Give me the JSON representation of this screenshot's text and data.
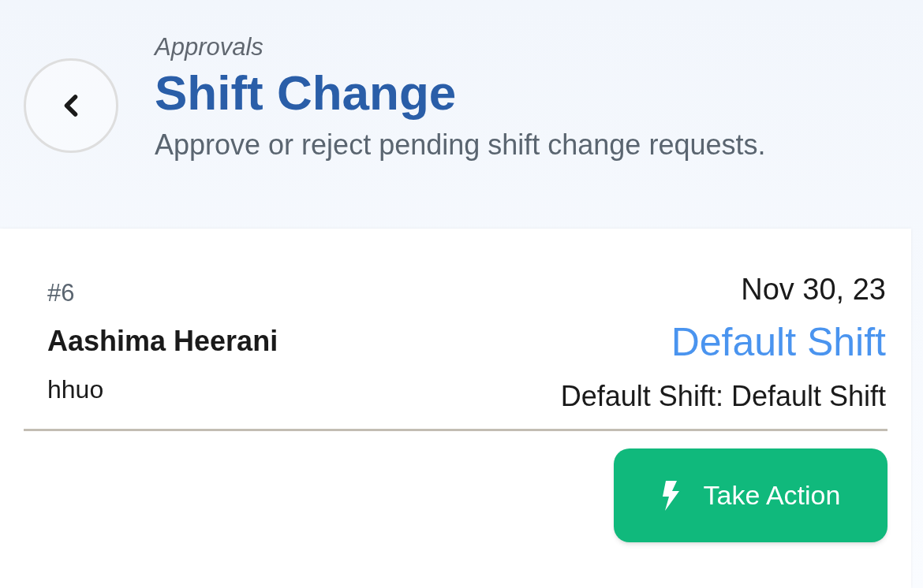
{
  "header": {
    "breadcrumb": "Approvals",
    "title": "Shift Change",
    "subtitle": "Approve or reject pending shift change requests."
  },
  "request": {
    "number": "#6",
    "date": "Nov 30, 23",
    "employee": "Aashima Heerani",
    "username": "hhuo",
    "shift": "Default Shift",
    "change": "Default Shift: Default Shift",
    "action": "Take Action"
  }
}
